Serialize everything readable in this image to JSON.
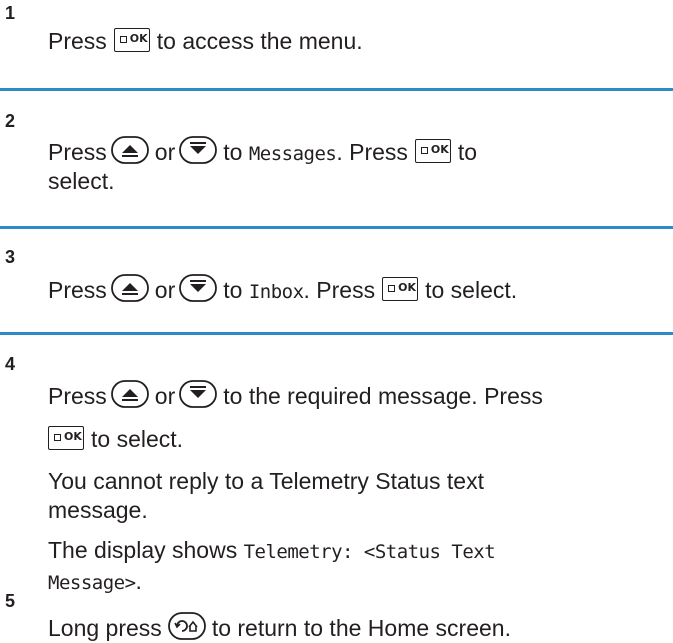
{
  "steps": [
    {
      "number": "1",
      "pre": "Press",
      "post": "to access the menu."
    },
    {
      "number": "2",
      "pre": "Press",
      "or": "or",
      "to": "to",
      "target": "Messages",
      "mid": ". Press",
      "post": "to",
      "line2": "select."
    },
    {
      "number": "3",
      "pre": "Press",
      "or": "or",
      "to": "to",
      "target": "Inbox",
      "mid": ". Press",
      "post": "to select."
    },
    {
      "number": "4",
      "pre": "Press",
      "or": "or",
      "post": "to the required message. Press",
      "line2": "to select.",
      "note1_a": "You cannot reply to a Telemetry Status text",
      "note1_b": "message.",
      "note2_pre": "The display shows",
      "note2_mono_a": "Telemetry: <Status Text",
      "note2_mono_b": "Message>",
      "note2_post": "."
    },
    {
      "number": "5",
      "pre": "Long press",
      "post": "to return to the Home screen."
    }
  ],
  "icons": {
    "ok_key_label": "OK",
    "ok_key": "menu-ok-key-icon",
    "up_key": "up-arrow-key-icon",
    "down_key": "down-arrow-key-icon",
    "back_home_key": "back-home-key-icon"
  },
  "colors": {
    "rule": "#2e8bc5",
    "text": "#231f20"
  }
}
